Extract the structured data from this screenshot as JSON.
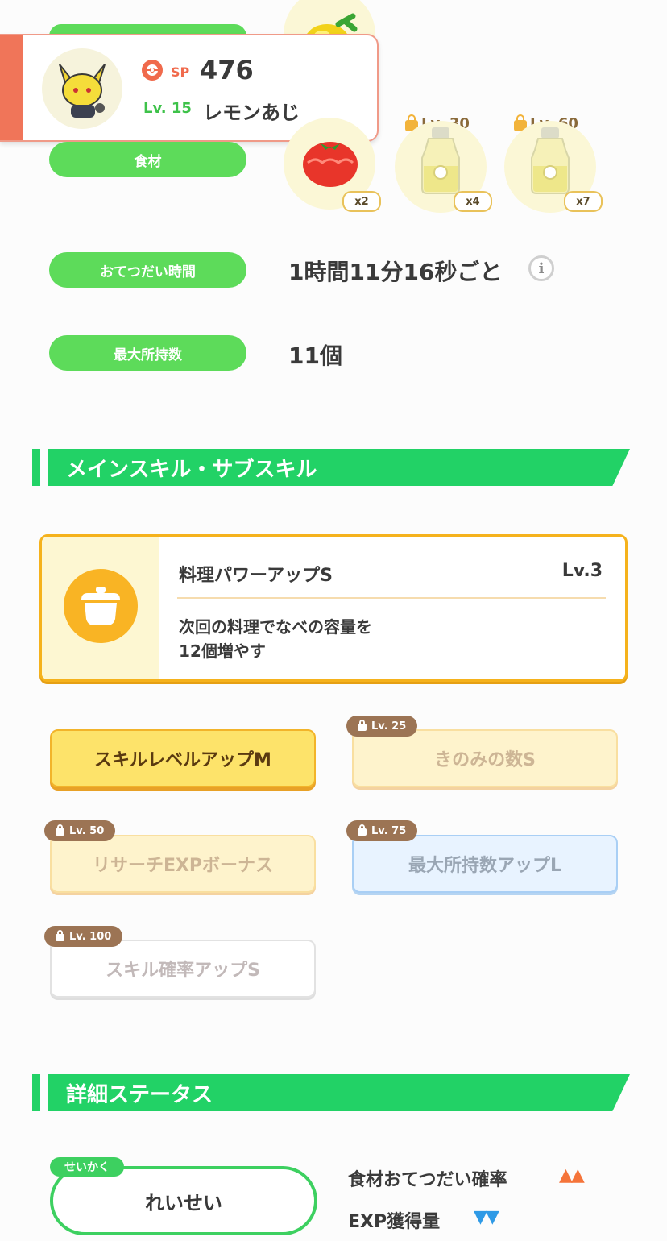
{
  "header_card": {
    "sp_label": "SP",
    "sp_value": "476",
    "level": "Lv. 15",
    "pokemon_name": "レモンあじ"
  },
  "ingredients": {
    "label": "食材",
    "items": [
      {
        "qty": "x2",
        "lock": ""
      },
      {
        "qty": "x4",
        "lock": "Lv. 30"
      },
      {
        "qty": "x7",
        "lock": "Lv. 60"
      }
    ]
  },
  "help_time": {
    "label": "おてつだい時間",
    "value": "1時間11分16秒ごと"
  },
  "max_carry": {
    "label": "最大所持数",
    "value": "11個"
  },
  "skills_section": {
    "title": "メインスキル・サブスキル",
    "main_skill": {
      "name": "料理パワーアップS",
      "level": "Lv.3",
      "desc_line1": "次回の料理でなべの容量を",
      "desc_line2": "12個増やす"
    },
    "sub_skills": [
      {
        "label": "スキルレベルアップM",
        "lock": ""
      },
      {
        "label": "きのみの数S",
        "lock": "Lv. 25"
      },
      {
        "label": "リサーチEXPボーナス",
        "lock": "Lv. 50"
      },
      {
        "label": "最大所持数アップL",
        "lock": "Lv. 75"
      },
      {
        "label": "スキル確率アップS",
        "lock": "Lv. 100"
      }
    ]
  },
  "details_section": {
    "title": "詳細ステータス",
    "nature_tag": "せいかく",
    "nature_value": "れいせい",
    "stat1_label": "食材おてつだい確率",
    "stat1_arrows": "▲▲",
    "stat2_label": "EXP獲得量",
    "stat2_arrows": "▼▼"
  },
  "colors": {
    "accent_green": "#22d266",
    "pill_green": "#5ddb5a",
    "up_orange": "#f5743a",
    "down_blue": "#2f9ae6"
  }
}
